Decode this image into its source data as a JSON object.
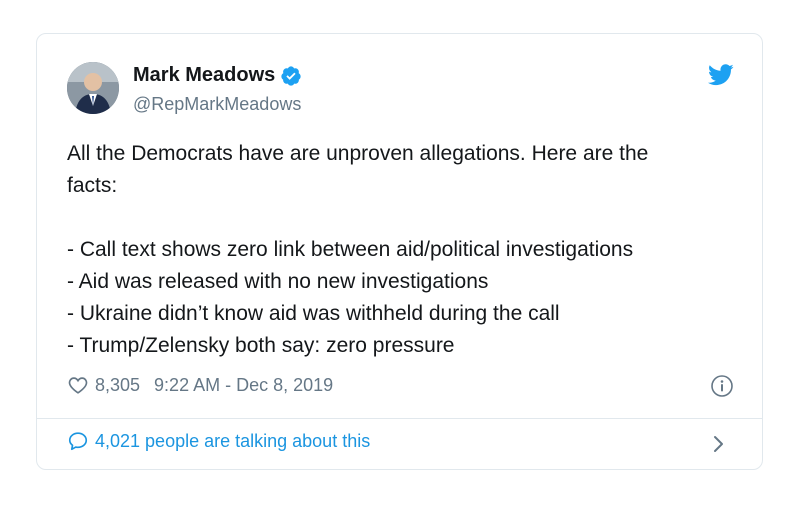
{
  "author": {
    "name": "Mark Meadows",
    "handle": "@RepMarkMeadows",
    "avatar_icon": "user-avatar",
    "verified_icon": "verified-badge-icon"
  },
  "brand": {
    "icon": "twitter-bird-icon",
    "accent_color": "#1da1f2"
  },
  "tweet": {
    "lines": [
      "All the Democrats have are unproven allegations. Here are the",
      "facts:",
      "",
      "- Call text shows zero link between aid/political investigations",
      "- Aid was released with no new investigations",
      "- Ukraine didn’t know aid was withheld during the call",
      "- Trump/Zelensky both say: zero pressure"
    ]
  },
  "meta": {
    "likes": "8,305",
    "timestamp": "9:22 AM - Dec 8, 2019",
    "heart_icon": "heart-icon",
    "info_icon": "info-icon"
  },
  "conversation": {
    "label": "4,021 people are talking about this",
    "icon": "speech-bubble-icon",
    "chevron_icon": "chevron-right-icon",
    "link_color": "#1b95e0"
  }
}
